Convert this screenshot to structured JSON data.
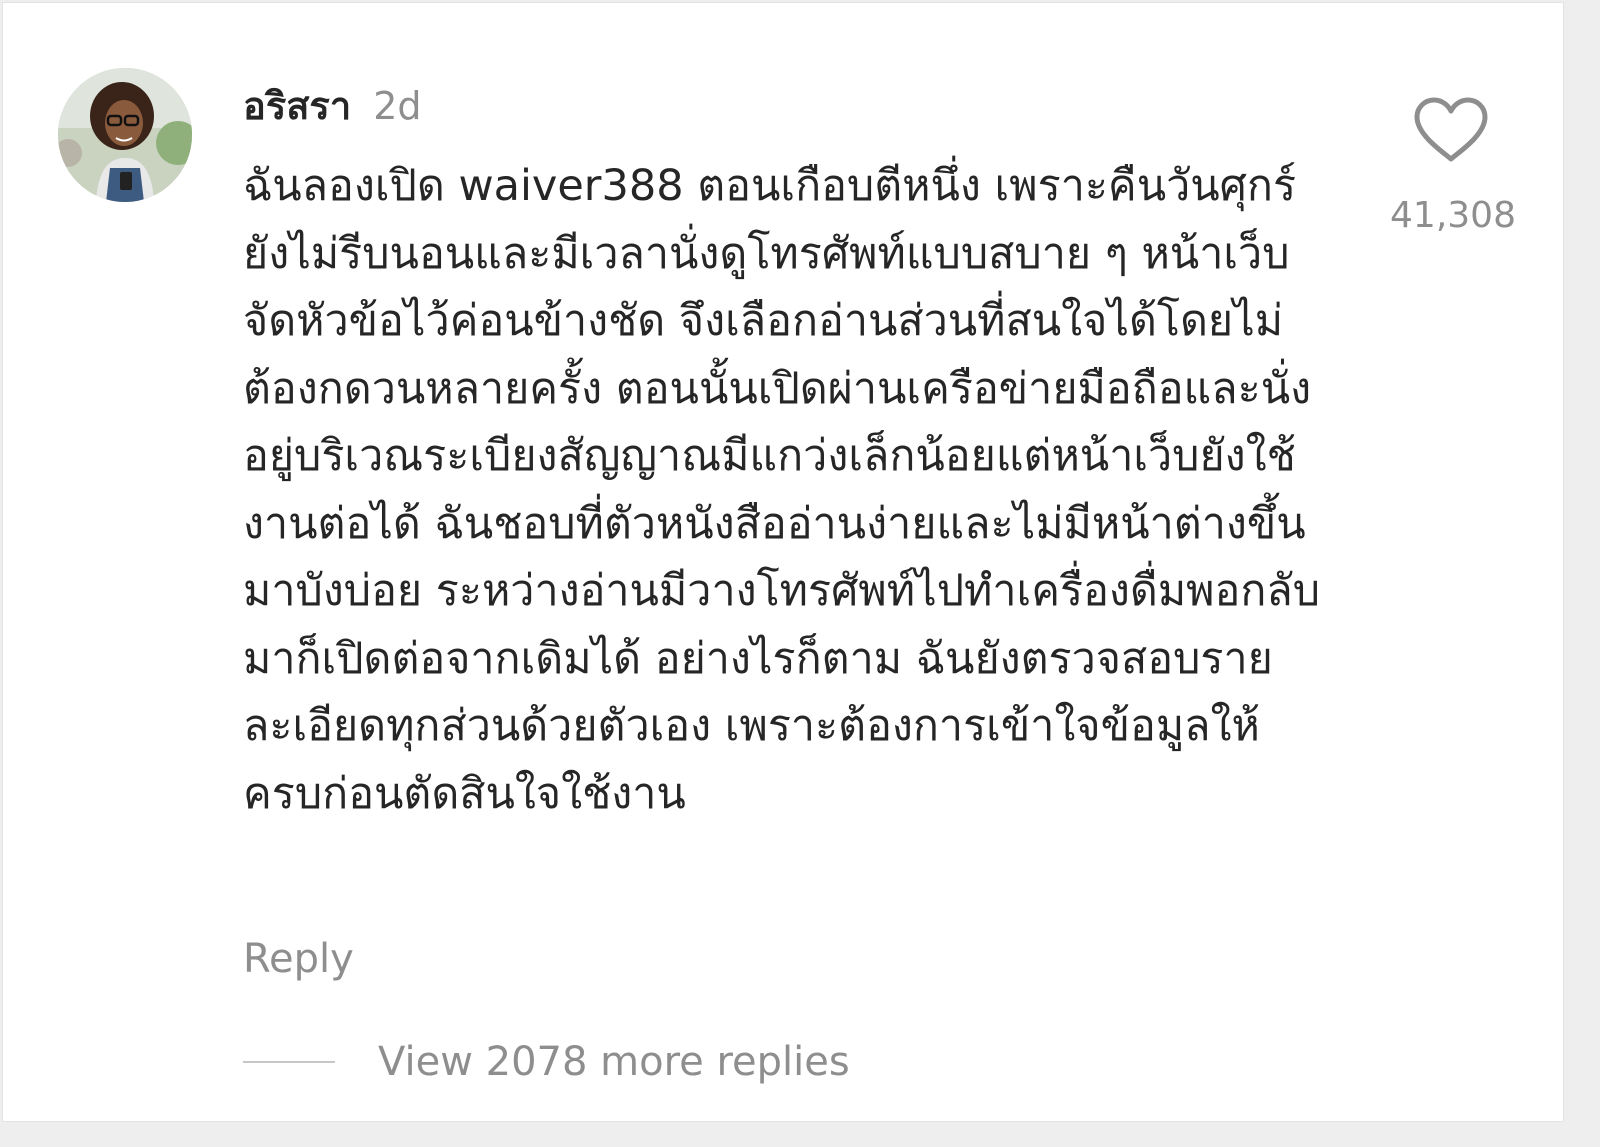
{
  "comment": {
    "username": "อริสรา",
    "timestamp": "2d",
    "text": "ฉันลองเปิด waiver388 ตอนเกือบตีหนึ่ง เพราะคืนวันศุกร์ยังไม่รีบนอนและมีเวลานั่งดูโทรศัพท์แบบสบาย ๆ หน้าเว็บจัดหัวข้อไว้ค่อนข้างชัด จึงเลือกอ่านส่วนที่สนใจได้โดยไม่ต้องกดวนหลายครั้ง ตอนนั้นเปิดผ่านเครือข่ายมือถือและนั่งอยู่บริเวณระเบียงสัญญาณมีแกว่งเล็กน้อยแต่หน้าเว็บยังใช้งานต่อได้ ฉันชอบที่ตัวหนังสืออ่านง่ายและไม่มีหน้าต่างขึ้นมาบังบ่อย ระหว่างอ่านมีวางโทรศัพท์ไปทำเครื่องดื่มพอกลับมาก็เปิดต่อจากเดิมได้ อย่างไรก็ตาม ฉันยังตรวจสอบรายละเอียดทุกส่วนด้วยตัวเอง เพราะต้องการเข้าใจข้อมูลให้ครบก่อนตัดสินใจใช้งาน",
    "like_count": "41,308",
    "like_icon": "heart-outline-icon",
    "reply_label": "Reply",
    "view_replies_label": "View 2078 more replies"
  },
  "colors": {
    "text_primary": "#262626",
    "text_secondary": "#8e8e8e",
    "background": "#ffffff"
  }
}
